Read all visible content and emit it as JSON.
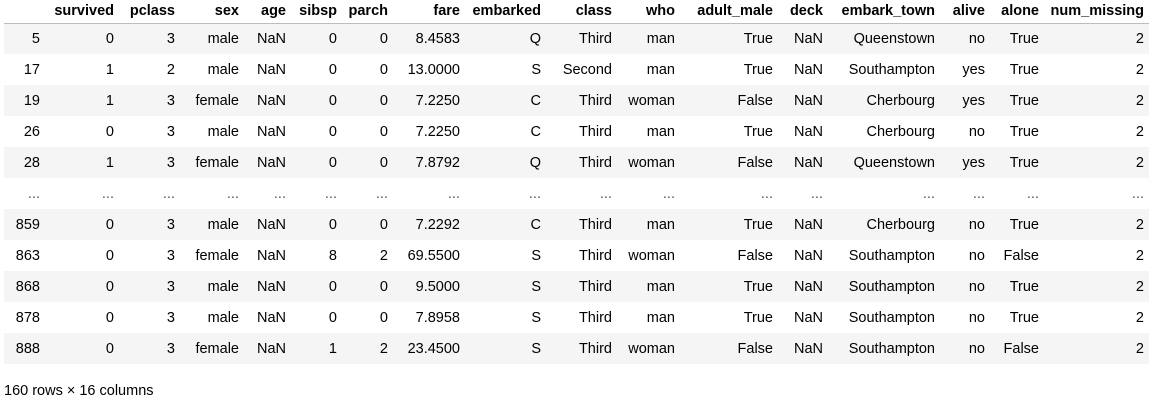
{
  "table": {
    "columns": [
      "",
      "survived",
      "pclass",
      "sex",
      "age",
      "sibsp",
      "parch",
      "fare",
      "embarked",
      "class",
      "who",
      "adult_male",
      "deck",
      "embark_town",
      "alive",
      "alone",
      "num_missing"
    ],
    "rows": [
      [
        "5",
        "0",
        "3",
        "male",
        "NaN",
        "0",
        "0",
        "8.4583",
        "Q",
        "Third",
        "man",
        "True",
        "NaN",
        "Queenstown",
        "no",
        "True",
        "2"
      ],
      [
        "17",
        "1",
        "2",
        "male",
        "NaN",
        "0",
        "0",
        "13.0000",
        "S",
        "Second",
        "man",
        "True",
        "NaN",
        "Southampton",
        "yes",
        "True",
        "2"
      ],
      [
        "19",
        "1",
        "3",
        "female",
        "NaN",
        "0",
        "0",
        "7.2250",
        "C",
        "Third",
        "woman",
        "False",
        "NaN",
        "Cherbourg",
        "yes",
        "True",
        "2"
      ],
      [
        "26",
        "0",
        "3",
        "male",
        "NaN",
        "0",
        "0",
        "7.2250",
        "C",
        "Third",
        "man",
        "True",
        "NaN",
        "Cherbourg",
        "no",
        "True",
        "2"
      ],
      [
        "28",
        "1",
        "3",
        "female",
        "NaN",
        "0",
        "0",
        "7.8792",
        "Q",
        "Third",
        "woman",
        "False",
        "NaN",
        "Queenstown",
        "yes",
        "True",
        "2"
      ],
      [
        "...",
        "...",
        "...",
        "...",
        "...",
        "...",
        "...",
        "...",
        "...",
        "...",
        "...",
        "...",
        "...",
        "...",
        "...",
        "...",
        "..."
      ],
      [
        "859",
        "0",
        "3",
        "male",
        "NaN",
        "0",
        "0",
        "7.2292",
        "C",
        "Third",
        "man",
        "True",
        "NaN",
        "Cherbourg",
        "no",
        "True",
        "2"
      ],
      [
        "863",
        "0",
        "3",
        "female",
        "NaN",
        "8",
        "2",
        "69.5500",
        "S",
        "Third",
        "woman",
        "False",
        "NaN",
        "Southampton",
        "no",
        "False",
        "2"
      ],
      [
        "868",
        "0",
        "3",
        "male",
        "NaN",
        "0",
        "0",
        "9.5000",
        "S",
        "Third",
        "man",
        "True",
        "NaN",
        "Southampton",
        "no",
        "True",
        "2"
      ],
      [
        "878",
        "0",
        "3",
        "male",
        "NaN",
        "0",
        "0",
        "7.8958",
        "S",
        "Third",
        "man",
        "True",
        "NaN",
        "Southampton",
        "no",
        "True",
        "2"
      ],
      [
        "888",
        "0",
        "3",
        "female",
        "NaN",
        "1",
        "2",
        "23.4500",
        "S",
        "Third",
        "woman",
        "False",
        "NaN",
        "Southampton",
        "no",
        "False",
        "2"
      ]
    ]
  },
  "footer": "160 rows × 16 columns",
  "colors": {
    "stripe": "#f5f5f5",
    "header_border": "#bdbdbd"
  }
}
